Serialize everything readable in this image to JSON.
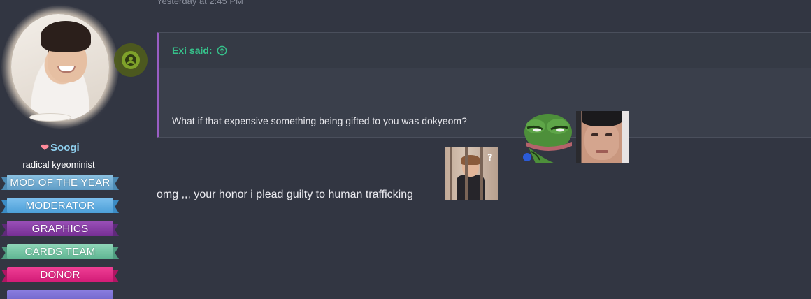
{
  "post": {
    "timestamp": "Yesterday at 2:45 PM",
    "quote": {
      "author_label": "Exi said:",
      "text": "What if that expensive something being gifted to you was dokyeom?",
      "emojis": [
        "pepe-smug-emoji",
        "face-closeup-emoji"
      ]
    },
    "reply_text": "omg ,,, your honor i plead guilty to human trafficking",
    "reply_emoji": "jail-bars-emoji"
  },
  "user": {
    "name": "Soogi",
    "name_icon": "heart-icon",
    "title": "radical kyeominist",
    "status_icon": "online-user-icon",
    "banners": [
      {
        "label": "Mod of the Year",
        "color": "#6aaad0"
      },
      {
        "label": "Moderator",
        "color": "#5aa8de"
      },
      {
        "label": "Graphics",
        "color": "#7e3a9c"
      },
      {
        "label": "Cards Team",
        "color": "#6cc2a0"
      },
      {
        "label": "Donor",
        "color": "#e0207e"
      }
    ]
  },
  "colors": {
    "background": "#323642",
    "quote_accent": "#9a5ec4",
    "quote_author": "#36c08a",
    "username": "#8fd0ef"
  }
}
